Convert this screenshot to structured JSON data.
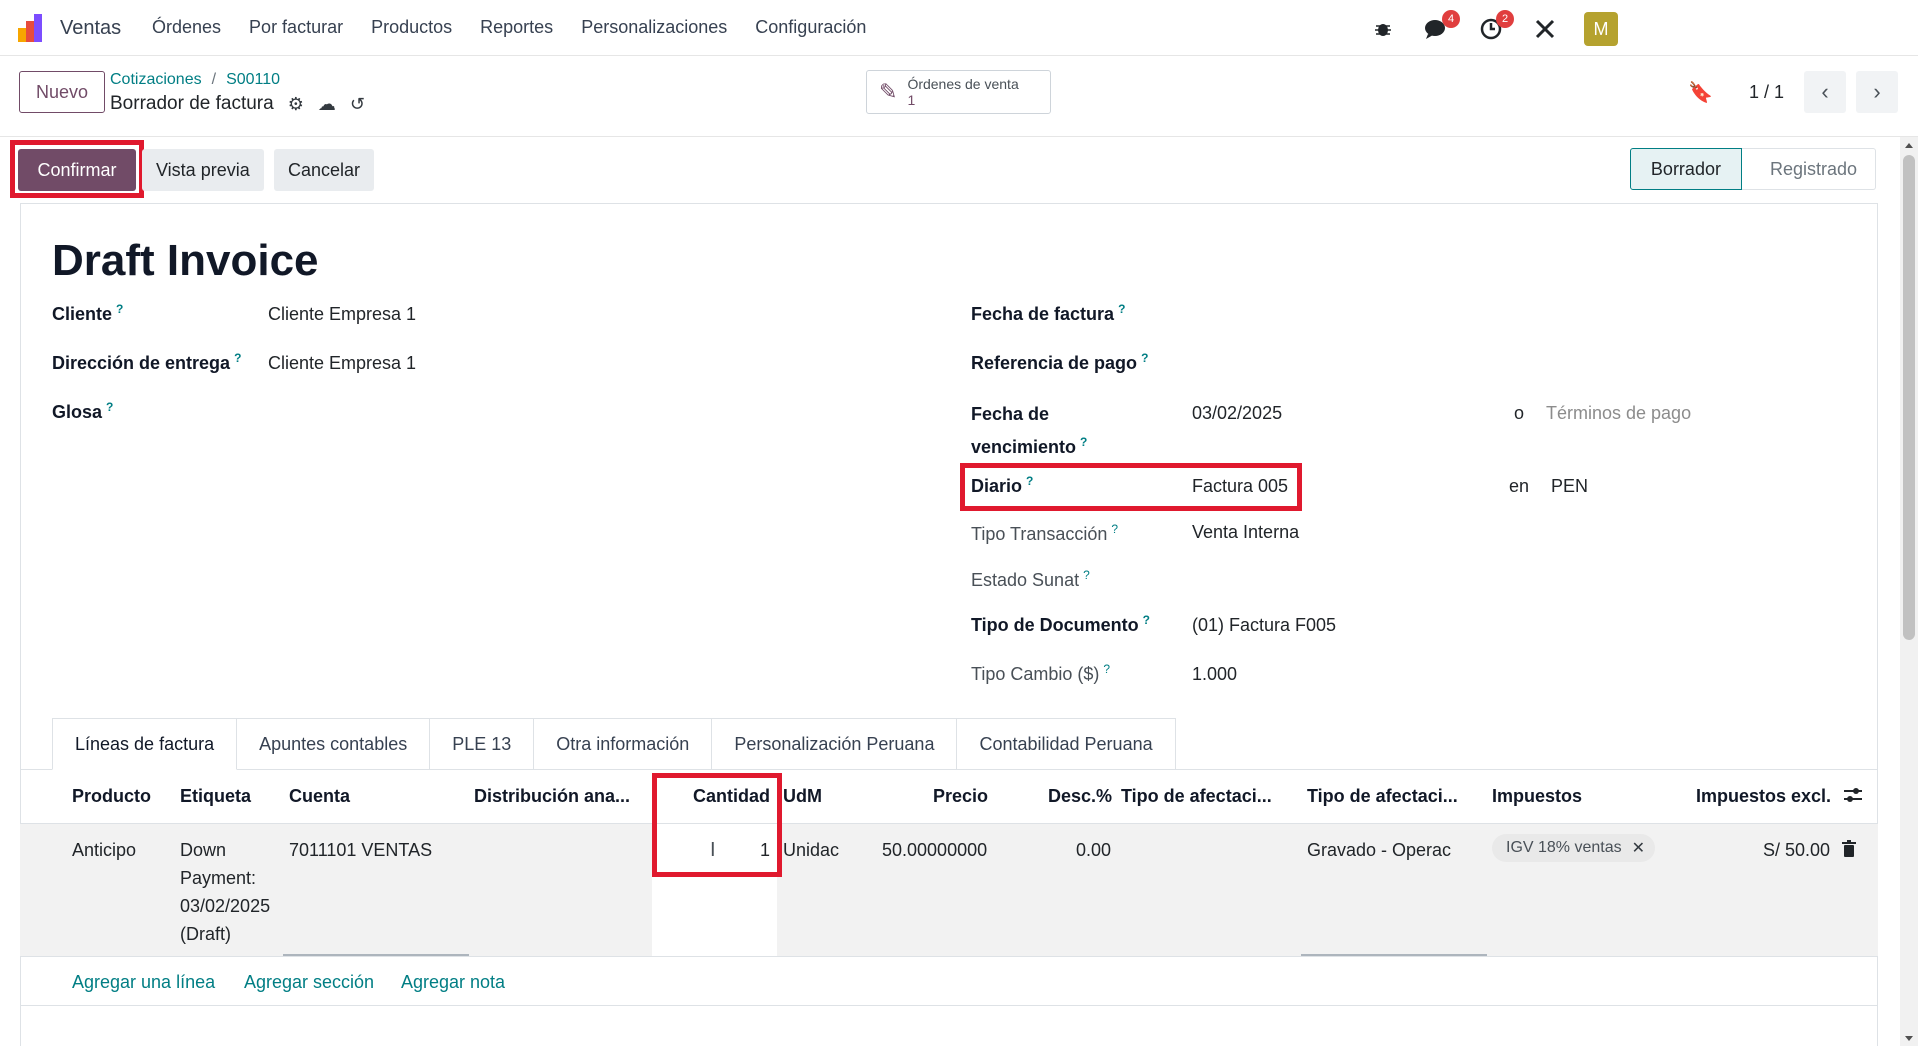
{
  "navbar": {
    "app_name": "Ventas",
    "menu": [
      "Órdenes",
      "Por facturar",
      "Productos",
      "Reportes",
      "Personalizaciones",
      "Configuración"
    ],
    "messages_badge": "4",
    "activities_badge": "2",
    "avatar_letter": "M"
  },
  "control": {
    "new_button": "Nuevo",
    "breadcrumb": [
      "Cotizaciones",
      "S00110"
    ],
    "record_title": "Borrador de factura",
    "smart_button": {
      "label": "Órdenes de venta",
      "count": "1"
    },
    "pager": "1 / 1"
  },
  "actions": {
    "confirm": "Confirmar",
    "preview": "Vista previa",
    "cancel": "Cancelar"
  },
  "status": {
    "active": "Borrador",
    "next": "Registrado"
  },
  "form": {
    "title": "Draft Invoice",
    "left": {
      "cliente_label": "Cliente",
      "cliente_value": "Cliente Empresa 1",
      "entrega_label": "Dirección de entrega",
      "entrega_value": "Cliente Empresa 1",
      "glosa_label": "Glosa"
    },
    "right": {
      "fecha_factura_label": "Fecha de factura",
      "ref_pago_label": "Referencia de pago",
      "vencimiento_label_1": "Fecha de",
      "vencimiento_label_2": "vencimiento",
      "vencimiento_value": "03/02/2025",
      "o_text": "o",
      "terminos_placeholder": "Términos de pago",
      "diario_label": "Diario",
      "diario_value": "Factura 005",
      "en_text": "en",
      "currency": "PEN",
      "tipo_transaccion_label": "Tipo Transacción",
      "tipo_transaccion_value": "Venta Interna",
      "estado_sunat_label": "Estado Sunat",
      "tipo_doc_label": "Tipo de Documento",
      "tipo_doc_value": "(01) Factura F005",
      "tipo_cambio_label": "Tipo Cambio ($)",
      "tipo_cambio_value": "1.000"
    }
  },
  "tabs": [
    "Líneas de factura",
    "Apuntes contables",
    "PLE 13",
    "Otra información",
    "Personalización Peruana",
    "Contabilidad Peruana"
  ],
  "table": {
    "headers": {
      "producto": "Producto",
      "etiqueta": "Etiqueta",
      "cuenta": "Cuenta",
      "distribucion": "Distribución ana...",
      "cantidad": "Cantidad",
      "udm": "UdM",
      "precio": "Precio",
      "desc": "Desc.%",
      "afect1": "Tipo de afectaci...",
      "afect2": "Tipo de afectaci...",
      "impuestos": "Impuestos",
      "impuestos_excl": "Impuestos excl."
    },
    "row": {
      "producto": "Anticipo",
      "etiqueta_lines": [
        "Down",
        "Payment:",
        "03/02/2025",
        "(Draft)"
      ],
      "cuenta": "7011101 VENTAS",
      "cantidad": "1",
      "udm": "Unidac",
      "precio": "50.00000000",
      "desc": "0.00",
      "afect2": "Gravado - Operac",
      "impuesto_tag": "IGV 18% ventas",
      "total": "S/ 50.00"
    }
  },
  "add_links": {
    "line": "Agregar una línea",
    "section": "Agregar sección",
    "note": "Agregar nota"
  }
}
